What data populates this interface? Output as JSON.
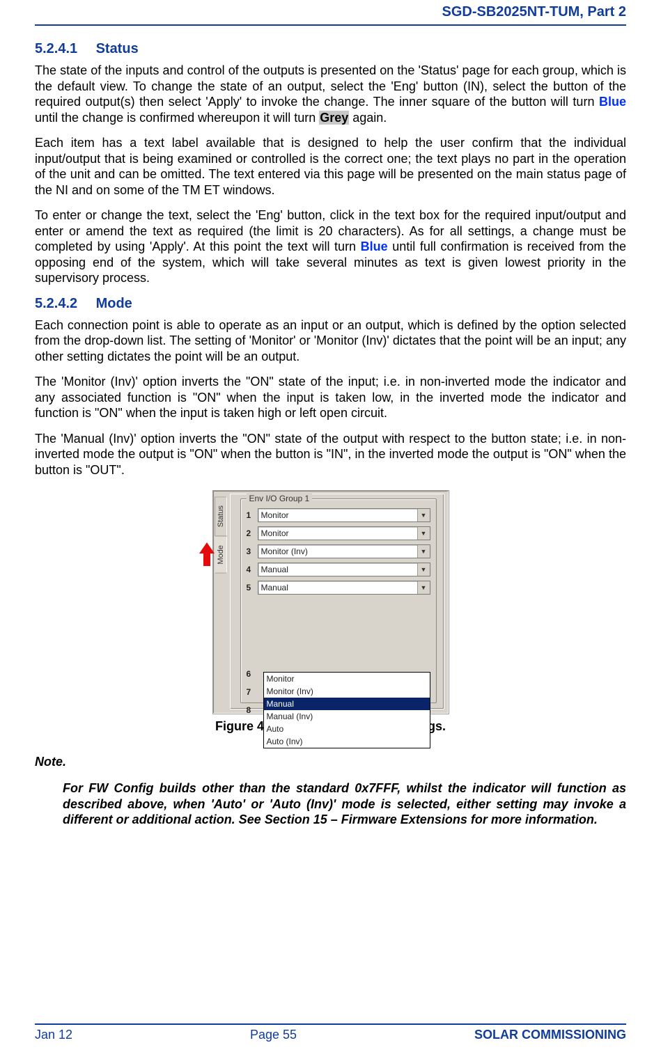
{
  "header": {
    "doc_id": "SGD-SB2025NT-TUM, Part 2"
  },
  "sections": {
    "s1": {
      "num": "5.2.4.1",
      "title": "Status"
    },
    "s2": {
      "num": "5.2.4.2",
      "title": "Mode"
    }
  },
  "body": {
    "p1a": "The state of the inputs and control of the outputs is presented on the 'Status' page for each group, which is the default view.  To change the state of an output, select the 'Eng' button (IN), select the button of the required output(s) then select 'Apply' to invoke the change.  The inner square of the button will turn ",
    "p1_blue": "Blue",
    "p1b": " until the change is confirmed whereupon it will turn ",
    "p1_grey": "Grey",
    "p1c": " again.",
    "p2": "Each item has a text label available that is designed to help the user confirm that the individual input/output that is being examined or controlled is the correct one; the text plays no part in the operation of the unit and can be omitted.  The text entered via this page will be presented on the main status page of the NI and on some of the TM ET windows.",
    "p3a": "To enter or change the text, select the 'Eng' button, click in the text box for the required input/output and enter or amend the text as required (the limit is 20 characters).  As for all settings, a change must be completed by using 'Apply'.  At this point the text will turn ",
    "p3_blue": "Blue",
    "p3b": " until full confirmation is received from the opposing end of the system, which will take several minutes as text is given lowest priority in the supervisory process.",
    "p4": "Each connection point is able to operate as an input or an output, which is defined by the option selected from the drop-down list.  The setting of 'Monitor' or 'Monitor (Inv)' dictates that the point will be an input; any other setting dictates the point will be an output.",
    "p5": "The 'Monitor (Inv)' option inverts the \"ON\" state of the input; i.e. in non-inverted mode the indicator and any associated function is \"ON\" when the input is taken low, in the inverted mode the indicator and function is \"ON\" when the input is taken high or left open circuit.",
    "p6": "The 'Manual (Inv)' option inverts the \"ON\" state of the output with respect to the button state; i.e. in non-inverted mode the output is \"ON\" when the button is \"IN\", in the inverted mode the output is \"ON\" when the button is \"OUT\"."
  },
  "figure": {
    "caption": "Figure 49.  Environment Mode settings.",
    "tabs": {
      "status": "Status",
      "mode": "Mode"
    },
    "group_title": "Env I/O Group 1",
    "rows": [
      {
        "n": "1",
        "value": "Monitor"
      },
      {
        "n": "2",
        "value": "Monitor"
      },
      {
        "n": "3",
        "value": "Monitor (Inv)"
      },
      {
        "n": "4",
        "value": "Manual"
      },
      {
        "n": "5",
        "value": "Manual"
      },
      {
        "n": "6",
        "value": ""
      },
      {
        "n": "7",
        "value": ""
      },
      {
        "n": "8",
        "value": ""
      }
    ],
    "dropdown_options": [
      "Monitor",
      "Monitor (Inv)",
      "Manual",
      "Manual (Inv)",
      "Auto",
      "Auto (Inv)"
    ],
    "dropdown_selected": "Manual"
  },
  "note": {
    "heading": "Note.",
    "body": "For FW Config builds other than the standard 0x7FFF, whilst the indicator will function as described above, when 'Auto' or 'Auto (Inv)' mode is selected, either setting may invoke a different or additional action.  See Section 15 – Firmware Extensions for more information."
  },
  "footer": {
    "left": "Jan 12",
    "center": "Page 55",
    "right": "SOLAR COMMISSIONING"
  }
}
